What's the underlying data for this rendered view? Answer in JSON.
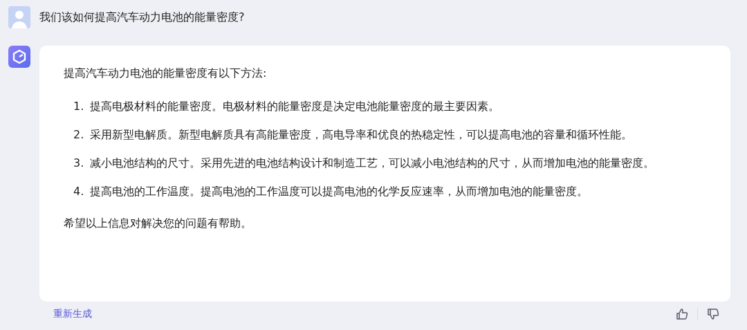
{
  "question": {
    "text": "我们该如何提高汽车动力电池的能量密度?"
  },
  "answer": {
    "intro": "提高汽车动力电池的能量密度有以下方法:",
    "items": [
      {
        "number": "1.",
        "text": "提高电极材料的能量密度。电极材料的能量密度是决定电池能量密度的最主要因素。"
      },
      {
        "number": "2.",
        "text": "采用新型电解质。新型电解质具有高能量密度，高电导率和优良的热稳定性，可以提高电池的容量和循环性能。"
      },
      {
        "number": "3.",
        "text": "减小电池结构的尺寸。采用先进的电池结构设计和制造工艺，可以减小电池结构的尺寸，从而增加电池的能量密度。"
      },
      {
        "number": "4.",
        "text": "提高电池的工作温度。提高电池的工作温度可以提高电池的化学反应速率，从而增加电池的能量密度。"
      }
    ],
    "closing": "希望以上信息对解决您的问题有帮助。"
  },
  "footer": {
    "regenerate": "重新生成"
  }
}
